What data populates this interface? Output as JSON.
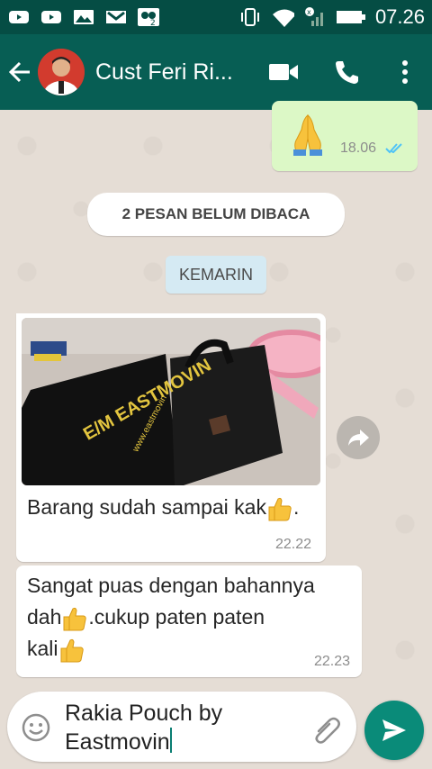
{
  "status_bar": {
    "time": "07.26",
    "left_icons": [
      "youtube-icon",
      "youtube-icon",
      "gallery-icon",
      "gmail-icon",
      "app-notification-icon"
    ],
    "right_icons": [
      "vibrate-icon",
      "wifi-icon",
      "no-signal-icon",
      "battery-icon"
    ]
  },
  "header": {
    "contact_name": "Cust Feri Ri...",
    "actions": [
      "video-call-icon",
      "call-icon",
      "more-options-icon"
    ]
  },
  "chat": {
    "unread_banner": "2 PESAN BELUM DIBACA",
    "date_chip": "KEMARIN",
    "outgoing": {
      "emoji": "folded-hands",
      "time": "18.06",
      "status": "read"
    },
    "messages": [
      {
        "has_image": true,
        "image_caption_text": "E/M EASTMOVIN",
        "image_caption_sub": "www.eastmovin",
        "text": "Barang sudah sampai kak",
        "emoji": "thumbs-up",
        "suffix": ".",
        "time": "22.22"
      },
      {
        "line1": "Sangat puas dengan bahannya",
        "line2": "dah",
        "line2_suffix": ".cukup paten paten",
        "line3": "kali",
        "time": "22.23"
      }
    ]
  },
  "composer": {
    "value_line1": "Rakia Pouch by",
    "value_line2": "Eastmovin"
  },
  "colors": {
    "status_bar": "#054d44",
    "app_bar": "#075e54",
    "outgoing_bubble": "#dcf8c6",
    "incoming_bubble": "#ffffff",
    "send_button": "#0a8b79",
    "read_ticks": "#4fc3f7"
  }
}
